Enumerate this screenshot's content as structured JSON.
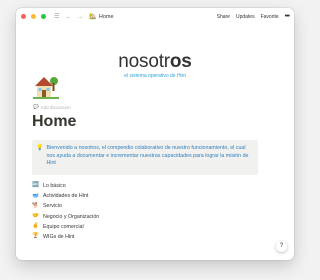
{
  "window": {
    "traffic_colors": [
      "#ff5f57",
      "#febc2e",
      "#28c840"
    ]
  },
  "topbar": {
    "breadcrumb_icon": "house-icon",
    "breadcrumb_label": "Home",
    "share_label": "Share",
    "updates_label": "Updates",
    "favorite_label": "Favorite",
    "more_label": "•••"
  },
  "logo": {
    "word_light": "nosotr",
    "word_bold": "os",
    "subtitle": "el sistema operativo de Hint"
  },
  "page": {
    "icon": "house-icon",
    "discussion_label": "Add discussion",
    "title": "Home"
  },
  "callout": {
    "icon": "lightbulb-icon",
    "text": "Bienvenido a nosotros, el compendio colaborativo de nuestro funcionamiento, el cual nos ayuda a documentar e incrementar nuestras capacidades para lograr la misión de Hint"
  },
  "links": [
    {
      "icon": "abc-icon",
      "label": "Lo básico"
    },
    {
      "icon": "bowl-icon",
      "label": "Actividades de Hint"
    },
    {
      "icon": "dog-icon",
      "label": "Servicio"
    },
    {
      "icon": "handshake-icon",
      "label": "Negocio y Organización"
    },
    {
      "icon": "victory-hand-icon",
      "label": "Equipo comercial"
    },
    {
      "icon": "trophy-icon",
      "label": "WIGs de Hint"
    }
  ],
  "help_label": "?"
}
